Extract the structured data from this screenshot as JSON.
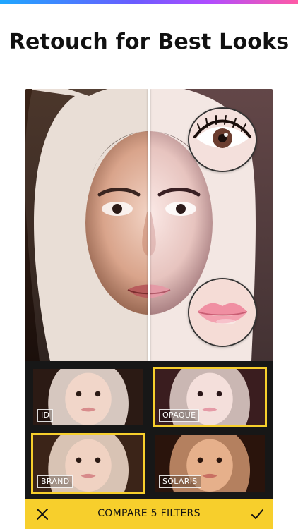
{
  "headline": "Retouch for Best Looks",
  "filters": [
    {
      "label": "ID",
      "selected": false
    },
    {
      "label": "OPAQUE",
      "selected": true
    },
    {
      "label": "BRAND",
      "selected": true
    },
    {
      "label": "SOLARIS",
      "selected": false
    }
  ],
  "action_bar": {
    "title": "COMPARE 5 FILTERS",
    "close_icon": "close-icon",
    "confirm_icon": "check-icon"
  },
  "colors": {
    "accent": "#f7cf2c",
    "gradient": [
      "#1ea7ff",
      "#6a5cff",
      "#b04cff",
      "#ff5aa5"
    ],
    "background": "#ffffff",
    "panel": "#171717"
  }
}
